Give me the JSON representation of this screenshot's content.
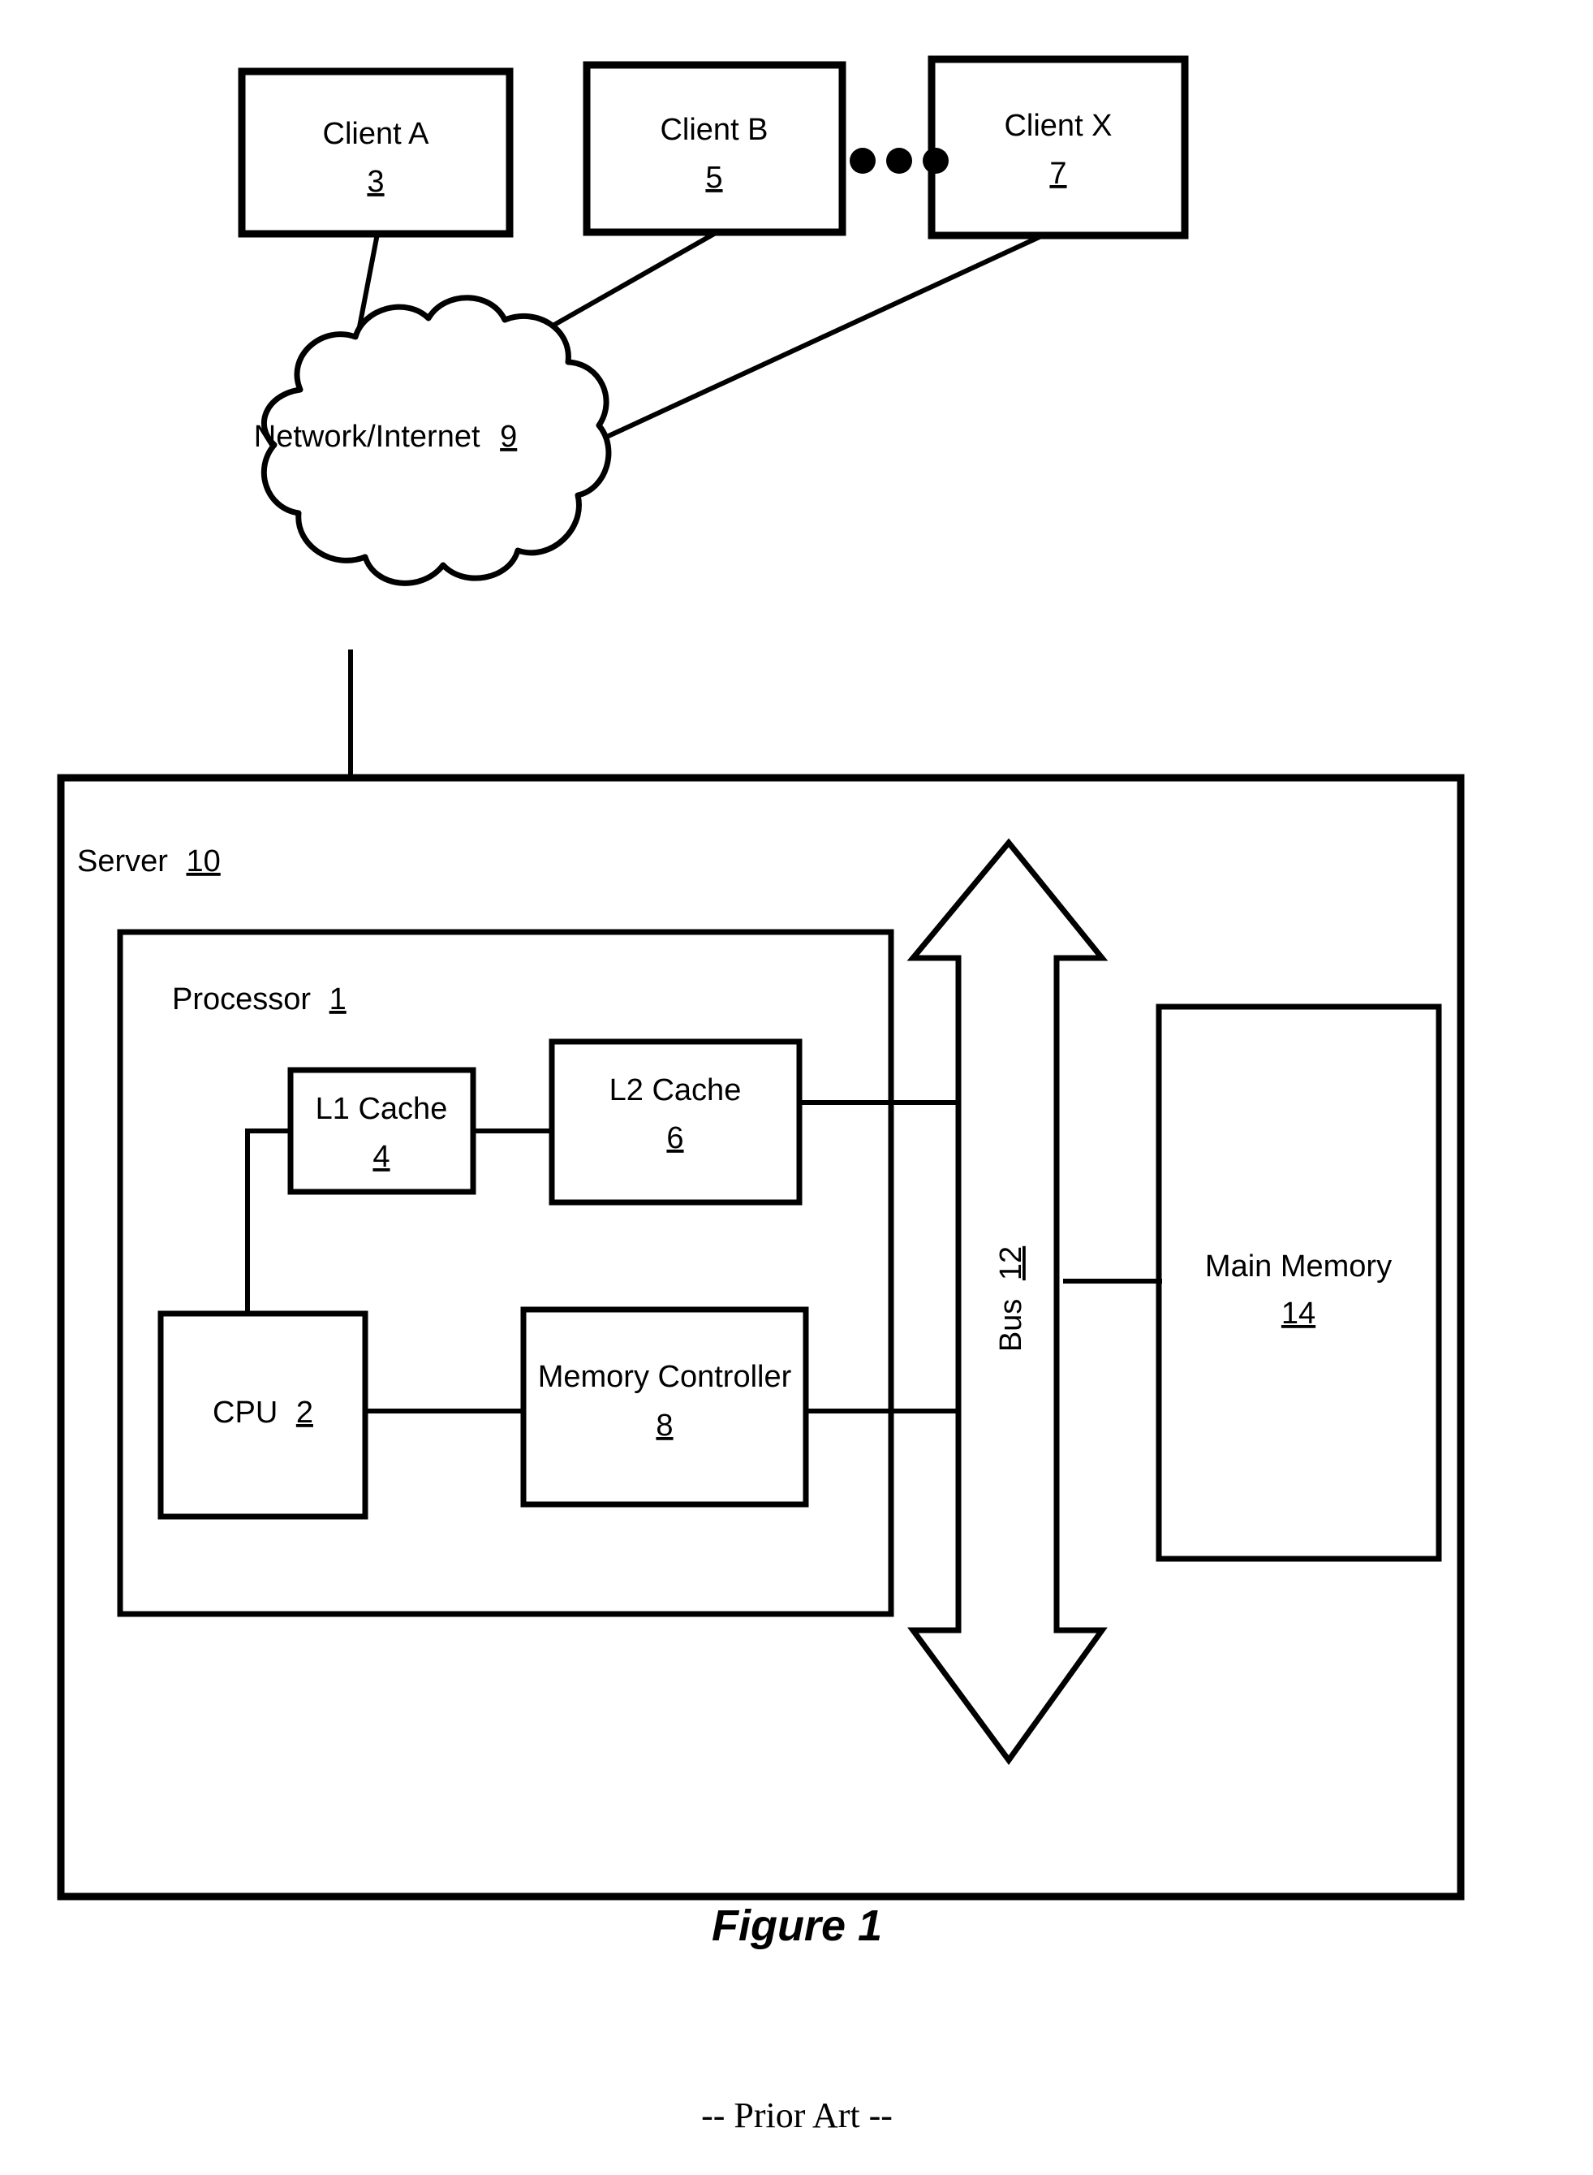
{
  "figure": {
    "caption": "Figure 1",
    "note": "-- Prior Art --"
  },
  "clients": [
    {
      "label": "Client A",
      "ref": "3"
    },
    {
      "label": "Client B",
      "ref": "5"
    },
    {
      "label": "Client X",
      "ref": "7"
    }
  ],
  "ellipsis": {
    "name": "ellipsis-dots",
    "count": 3
  },
  "network": {
    "label": "Network/Internet",
    "ref": "9"
  },
  "server": {
    "label": "Server",
    "ref": "10"
  },
  "processor": {
    "label": "Processor",
    "ref": "1"
  },
  "components": {
    "l1_cache": {
      "label": "L1 Cache",
      "ref": "4"
    },
    "l2_cache": {
      "label": "L2 Cache",
      "ref": "6"
    },
    "cpu": {
      "label": "CPU",
      "ref": "2"
    },
    "memory_controller": {
      "label": "Memory Controller",
      "ref": "8"
    },
    "main_memory": {
      "label": "Main Memory",
      "ref": "14"
    },
    "bus": {
      "label": "Bus",
      "ref": "12"
    }
  },
  "colors": {
    "ink": "#000000",
    "paper": "#ffffff"
  }
}
